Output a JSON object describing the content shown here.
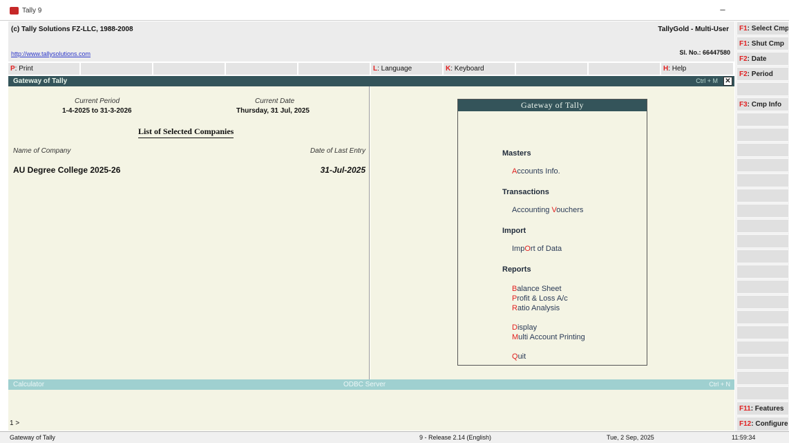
{
  "window": {
    "title": "Tally 9",
    "minimize": "–"
  },
  "header": {
    "copyright": "(c) Tally Solutions FZ-LLC, 1988-2008",
    "url": "http://www.tallysolutions.com",
    "edition": "TallyGold - Multi-User",
    "serial": "Sl. No.: 66447580"
  },
  "menu": [
    {
      "key": "P",
      "label": ": Print"
    },
    {
      "key": "",
      "label": ""
    },
    {
      "key": "",
      "label": ""
    },
    {
      "key": "",
      "label": ""
    },
    {
      "key": "",
      "label": ""
    },
    {
      "key": "L",
      "label": ": Language"
    },
    {
      "key": "K",
      "label": ": Keyboard"
    },
    {
      "key": "",
      "label": ""
    },
    {
      "key": "",
      "label": ""
    },
    {
      "key": "H",
      "label": ": Help"
    }
  ],
  "gateway_bar": {
    "title": "Gateway of Tally",
    "shortcut": "Ctrl + M"
  },
  "left_panel": {
    "current_period_label": "Current Period",
    "current_period": "1-4-2025 to 31-3-2026",
    "current_date_label": "Current Date",
    "current_date": "Thursday, 31 Jul, 2025",
    "list_title": "List of Selected Companies",
    "col_name": "Name of Company",
    "col_last_entry": "Date of Last Entry",
    "companies": [
      {
        "name": "AU Degree College 2025-26",
        "last_entry": "31-Jul-2025"
      }
    ]
  },
  "gateway_menu": {
    "title": "Gateway of Tally",
    "sections": [
      {
        "name": "Masters",
        "items": [
          {
            "pre": "",
            "key": "A",
            "post": "ccounts Info."
          }
        ]
      },
      {
        "name": "Transactions",
        "items": [
          {
            "pre": "Accounting ",
            "key": "V",
            "post": "ouchers"
          }
        ]
      },
      {
        "name": "Import",
        "items": [
          {
            "pre": "Imp",
            "key": "O",
            "post": "rt of Data"
          }
        ]
      },
      {
        "name": "Reports",
        "items": [
          {
            "pre": "",
            "key": "B",
            "post": "alance Sheet"
          },
          {
            "pre": "",
            "key": "P",
            "post": "rofit & Loss A/c"
          },
          {
            "pre": "",
            "key": "R",
            "post": "atio Analysis"
          },
          {
            "pre": "",
            "key": "D",
            "post": "isplay"
          },
          {
            "pre": "",
            "key": "M",
            "post": "ulti Account Printing"
          },
          {
            "pre": "",
            "key": "Q",
            "post": "uit"
          }
        ]
      }
    ]
  },
  "bottom": {
    "calculator": "Calculator",
    "odbc": "ODBC Server",
    "ctrl": "Ctrl + N",
    "prompt": "1    >"
  },
  "status": {
    "left": "Gateway of Tally",
    "release": "9 - Release 2.14 (English)",
    "date": "Tue, 2 Sep, 2025",
    "time": "11:59:34"
  },
  "side_buttons": [
    {
      "key": "F1",
      "label": ": Select Cmp"
    },
    {
      "key": "F1",
      "label": ": Shut Cmp"
    },
    {
      "key": "F2",
      "label": ": Date"
    },
    {
      "key": "F2",
      "label": ": Period"
    },
    {
      "key": "",
      "label": ""
    },
    {
      "key": "F3",
      "label": ": Cmp Info"
    },
    {
      "key": "F11",
      "label": ": Features"
    },
    {
      "key": "F12",
      "label": ": Configure"
    }
  ],
  "colors": {
    "title_bar": "#34545a",
    "panel_bg": "#f4f4e4",
    "hotkey": "#e02020",
    "calc_bar": "#9fd0d0"
  }
}
